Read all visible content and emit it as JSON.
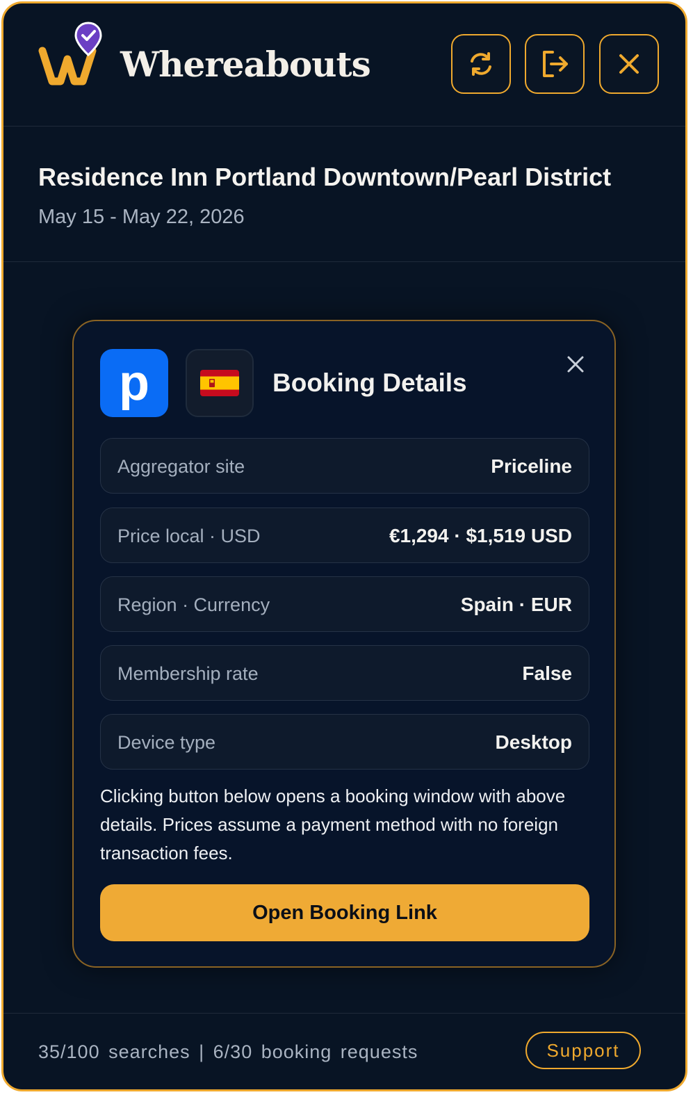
{
  "app": {
    "brand": "Whereabouts",
    "accent_color": "#efa92e",
    "background_color": "#081424"
  },
  "header": {
    "buttons": [
      {
        "name": "refresh-button",
        "icon": "refresh-icon"
      },
      {
        "name": "logout-button",
        "icon": "logout-icon"
      },
      {
        "name": "close-button",
        "icon": "close-icon"
      }
    ]
  },
  "hotel": {
    "name": "Residence Inn Portland Downtown/Pearl District",
    "dates": "May 15 - May 22, 2026"
  },
  "modal": {
    "site_logo_letter": "p",
    "site_logo_color": "#0a6cf5",
    "flag_icon": "spain-flag-icon",
    "title": "Booking Details",
    "rows": [
      {
        "label": "Aggregator site",
        "value": "Priceline"
      },
      {
        "label": "Price local · USD",
        "value": "€1,294 · $1,519 USD"
      },
      {
        "label": "Region · Currency",
        "value": "Spain · EUR"
      },
      {
        "label": "Membership rate",
        "value": "False"
      },
      {
        "label": "Device type",
        "value": "Desktop"
      }
    ],
    "note": "Clicking button below opens a booking window with above details. Prices assume a payment method with no foreign transaction fees.",
    "open_button_label": "Open Booking Link"
  },
  "footer": {
    "usage": "35/100 searches | 6/30 booking requests",
    "support_label": "Support"
  }
}
